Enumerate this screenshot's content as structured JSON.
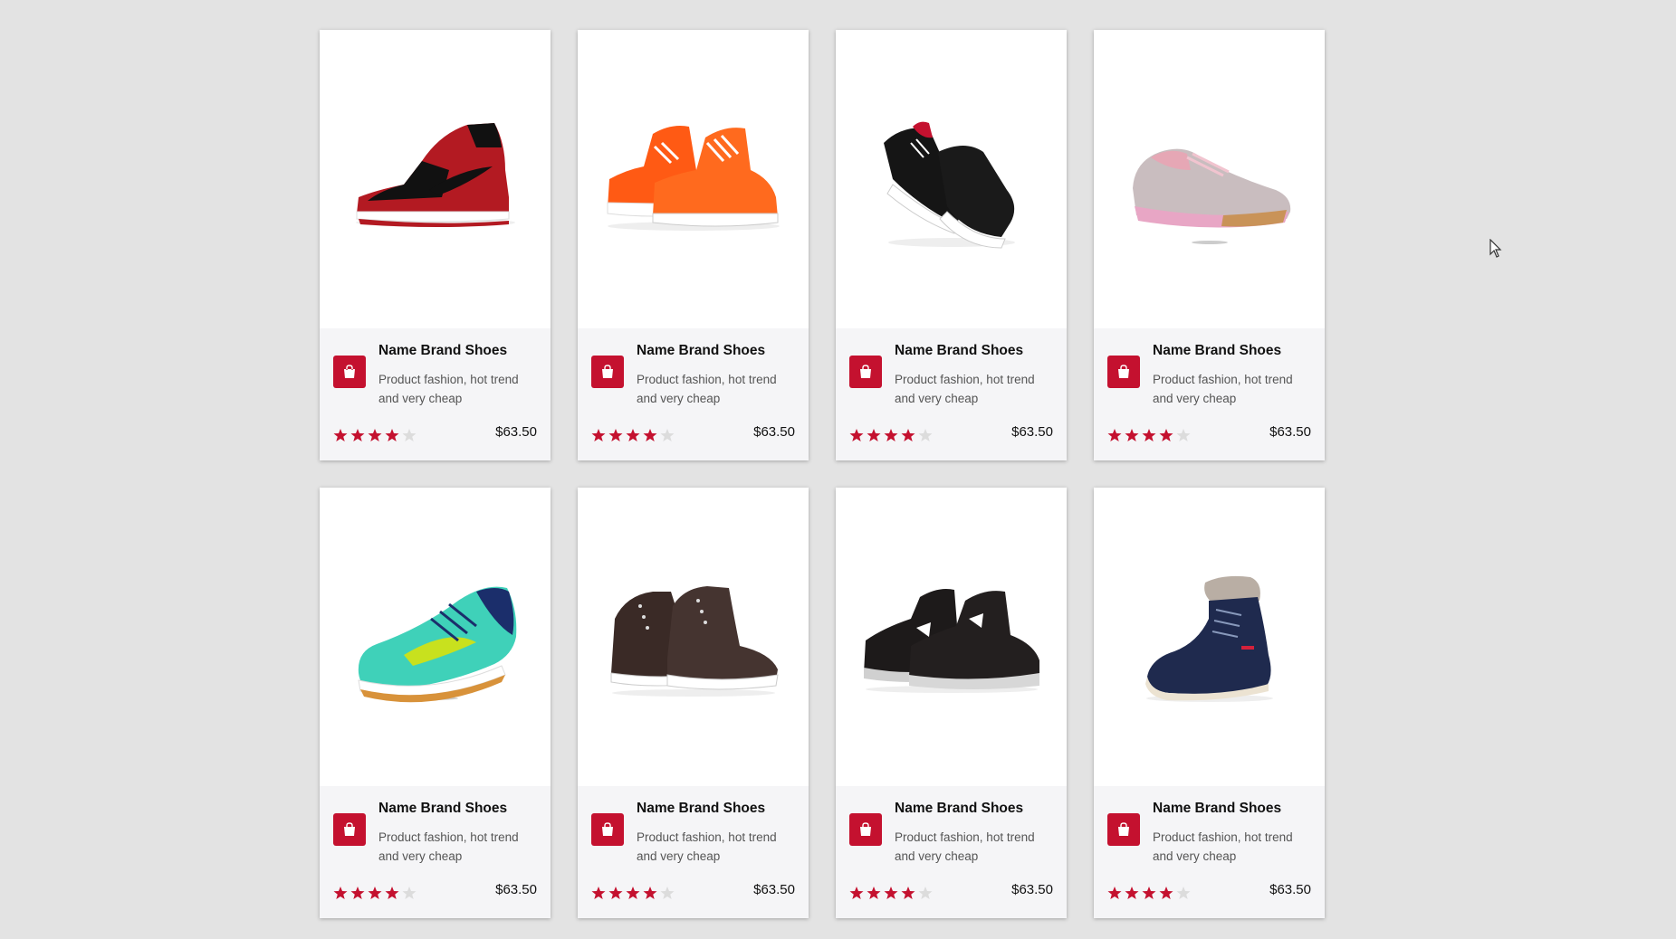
{
  "theme": {
    "accent": "#c4112f",
    "background": "#e3e3e3",
    "card_footer": "#f5f5f7",
    "star_empty": "#dcdcdc"
  },
  "products": [
    {
      "name": "Name Brand Shoes",
      "description": "Product fashion, hot trend and very cheap",
      "price": "$63.50",
      "rating": 4,
      "max_rating": 5,
      "image": "red-black-high-top-sneaker"
    },
    {
      "name": "Name Brand Shoes",
      "description": "Product fashion, hot trend and very cheap",
      "price": "$63.50",
      "rating": 4,
      "max_rating": 5,
      "image": "orange-basketball-sneakers-pair"
    },
    {
      "name": "Name Brand Shoes",
      "description": "Product fashion, hot trend and very cheap",
      "price": "$63.50",
      "rating": 4,
      "max_rating": 5,
      "image": "black-white-skate-sneakers-pair"
    },
    {
      "name": "Name Brand Shoes",
      "description": "Product fashion, hot trend and very cheap",
      "price": "$63.50",
      "rating": 4,
      "max_rating": 5,
      "image": "pink-grey-running-shoe"
    },
    {
      "name": "Name Brand Shoes",
      "description": "Product fashion, hot trend and very cheap",
      "price": "$63.50",
      "rating": 4,
      "max_rating": 5,
      "image": "teal-court-shoe"
    },
    {
      "name": "Name Brand Shoes",
      "description": "Product fashion, hot trend and very cheap",
      "price": "$63.50",
      "rating": 4,
      "max_rating": 5,
      "image": "brown-leather-high-top-pair"
    },
    {
      "name": "Name Brand Shoes",
      "description": "Product fashion, hot trend and very cheap",
      "price": "$63.50",
      "rating": 4,
      "max_rating": 5,
      "image": "black-grey-basketball-sneakers-pair"
    },
    {
      "name": "Name Brand Shoes",
      "description": "Product fashion, hot trend and very cheap",
      "price": "$63.50",
      "rating": 4,
      "max_rating": 5,
      "image": "navy-fur-lined-boot"
    }
  ]
}
